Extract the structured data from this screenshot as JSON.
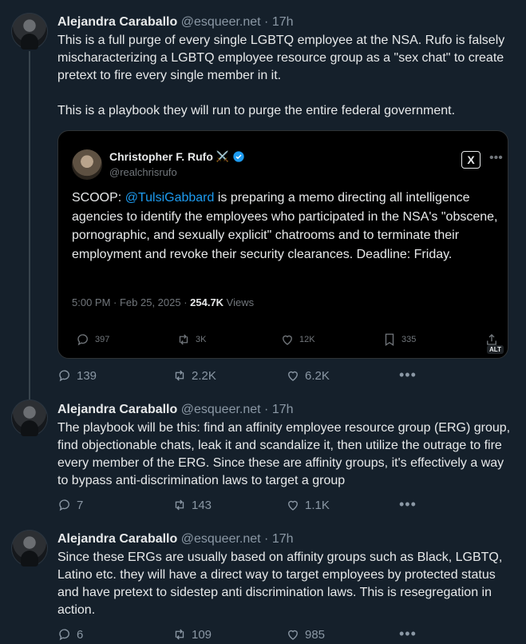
{
  "posts": [
    {
      "author": "Alejandra Caraballo",
      "handle": "@esqueer.net",
      "sep": " · ",
      "time": "17h",
      "paragraphs": [
        "This is a full purge of every single LGBTQ employee at the NSA. Rufo is falsely mischaracterizing a LGBTQ employee resource group as a \"sex chat\" to create pretext to fire every single member in it.",
        "This is a playbook they will run to purge the entire federal government."
      ],
      "replies": "139",
      "reposts": "2.2K",
      "likes": "6.2K"
    },
    {
      "author": "Alejandra Caraballo",
      "handle": "@esqueer.net",
      "sep": " · ",
      "time": "17h",
      "paragraphs": [
        "The playbook will be this: find an affinity employee resource group (ERG) group, find objectionable chats, leak it and scandalize it, then utilize the outrage to fire every member of the ERG. Since these are affinity groups, it's effectively a way to bypass anti-discrimination laws to target a group"
      ],
      "replies": "7",
      "reposts": "143",
      "likes": "1.1K"
    },
    {
      "author": "Alejandra Caraballo",
      "handle": "@esqueer.net",
      "sep": " · ",
      "time": "17h",
      "paragraphs": [
        "Since these ERGs are usually based on affinity groups such as Black, LGBTQ, Latino etc. they will have a direct way to target employees by protected status and have pretext to sidestep anti discrimination laws. This is resegregation in action."
      ],
      "replies": "6",
      "reposts": "109",
      "likes": "985"
    }
  ],
  "quote": {
    "author": "Christopher F. Rufo",
    "author_emoji": "⚔️",
    "handle": "@realchrisrufo",
    "text_before": "SCOOP: ",
    "mention": "@TulsiGabbard",
    "text_after": " is preparing a memo directing all intelligence agencies to identify the employees who participated in the NSA's \"obscene, pornographic, and sexually explicit\" chatrooms and to terminate their employment and revoke their security clearances. Deadline: Friday.",
    "timestamp": "5:00 PM · Feb 25, 2025 · ",
    "views_count": "254.7K",
    "views_label": " Views",
    "replies": "397",
    "reposts": "3K",
    "likes": "12K",
    "bookmarks": "335",
    "alt_badge": "ALT",
    "x_logo": "X"
  },
  "colors": {
    "background": "#15202b",
    "quote_background": "#000000",
    "link": "#1d9bf0",
    "muted": "#8b98a5"
  },
  "icons": [
    "reply-icon",
    "repost-icon",
    "like-icon",
    "bookmark-icon",
    "share-icon",
    "more-icon",
    "verified-icon"
  ]
}
